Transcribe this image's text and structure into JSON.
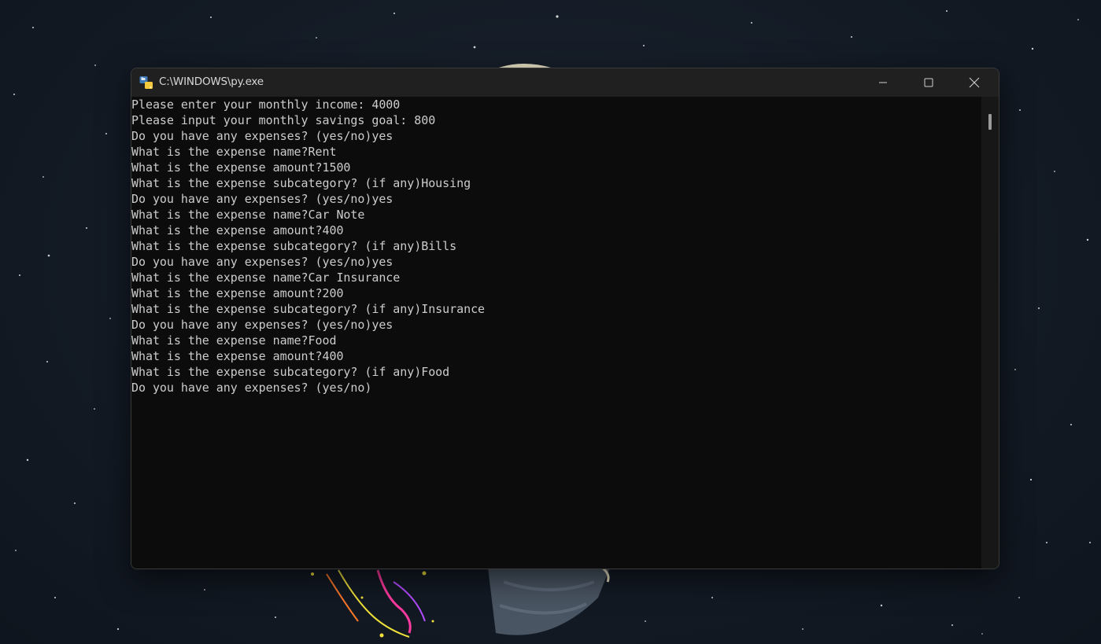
{
  "window": {
    "title": "C:\\WINDOWS\\py.exe",
    "app_icon": "python-icon",
    "controls": {
      "minimize_icon": "minimize-icon",
      "maximize_icon": "maximize-icon",
      "close_icon": "close-icon"
    }
  },
  "console": {
    "background": "#0c0c0c",
    "text_color": "#cccccc",
    "lines": [
      "Please enter your monthly income: 4000",
      "Please input your monthly savings goal: 800",
      "Do you have any expenses? (yes/no)yes",
      "What is the expense name?Rent",
      "What is the expense amount?1500",
      "What is the expense subcategory? (if any)Housing",
      "Do you have any expenses? (yes/no)yes",
      "What is the expense name?Car Note",
      "What is the expense amount?400",
      "What is the expense subcategory? (if any)Bills",
      "Do you have any expenses? (yes/no)yes",
      "What is the expense name?Car Insurance",
      "What is the expense amount?200",
      "What is the expense subcategory? (if any)Insurance",
      "Do you have any expenses? (yes/no)yes",
      "What is the expense name?Food",
      "What is the expense amount?400",
      "What is the expense subcategory? (if any)Food",
      "Do you have any expenses? (yes/no)"
    ]
  }
}
